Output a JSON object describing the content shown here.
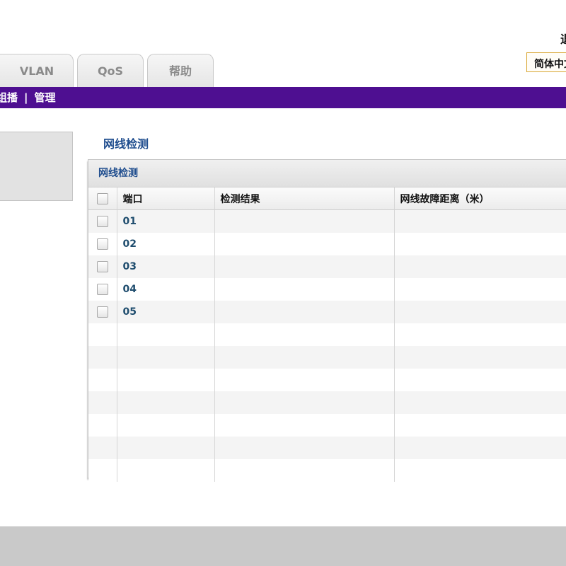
{
  "header": {
    "top_right_text": "退",
    "language_select": "简体中文"
  },
  "tabs": [
    {
      "label": "VLAN"
    },
    {
      "label": "QoS"
    },
    {
      "label": "帮助"
    }
  ],
  "nav": {
    "items": [
      "组播",
      "管理"
    ],
    "separator": "|"
  },
  "page": {
    "title": "网线检测"
  },
  "panel": {
    "title": "网线检测",
    "columns": [
      "端口",
      "检测结果",
      "网线故障距离（米）"
    ],
    "rows": [
      {
        "port": "01",
        "result": "",
        "distance": ""
      },
      {
        "port": "02",
        "result": "",
        "distance": ""
      },
      {
        "port": "03",
        "result": "",
        "distance": ""
      },
      {
        "port": "04",
        "result": "",
        "distance": ""
      },
      {
        "port": "05",
        "result": "",
        "distance": ""
      }
    ]
  },
  "colors": {
    "navbar": "#4e0f91",
    "title_blue": "#1f4d8e",
    "lang_border": "#d8a531"
  }
}
